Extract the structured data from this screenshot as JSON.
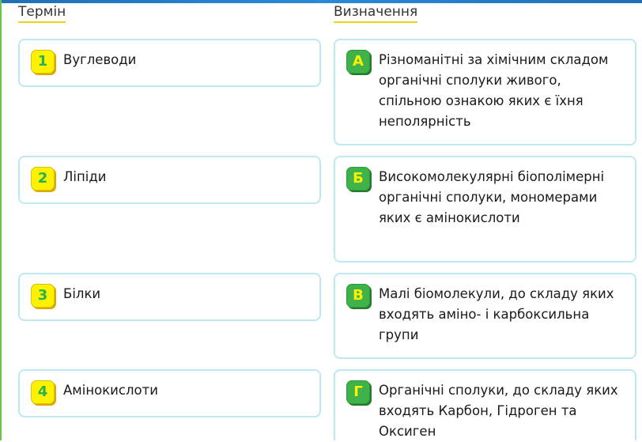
{
  "headers": {
    "term": "Термін",
    "definition": "Визначення"
  },
  "terms": [
    {
      "badge": "1",
      "label": "Вуглеводи"
    },
    {
      "badge": "2",
      "label": "Ліпіди"
    },
    {
      "badge": "3",
      "label": "Білки"
    },
    {
      "badge": "4",
      "label": "Амінокислоти"
    }
  ],
  "definitions": [
    {
      "badge": "А",
      "text": "Різноманітні за хімічним складом органічні сполуки живого, спільною ознакою яких є їхня неполярність"
    },
    {
      "badge": "Б",
      "text": "Високомолекулярні біополімерні органічні сполуки, мономерами яких є амінокислоти"
    },
    {
      "badge": "В",
      "text": "Малі біомолекули, до складу яких входять аміно- і карбоксильна групи"
    },
    {
      "badge": "Г",
      "text": "Органічні сполуки, до складу яких входять Карбон, Гідроген та Оксиген"
    }
  ],
  "colors": {
    "card_border": "#bfe8f2",
    "number_badge": "#fff200",
    "letter_badge": "#3fb24a",
    "header_underline": "#f0d21c",
    "top_bar": "#1e6fb8",
    "left_rule": "#6cc24a"
  }
}
